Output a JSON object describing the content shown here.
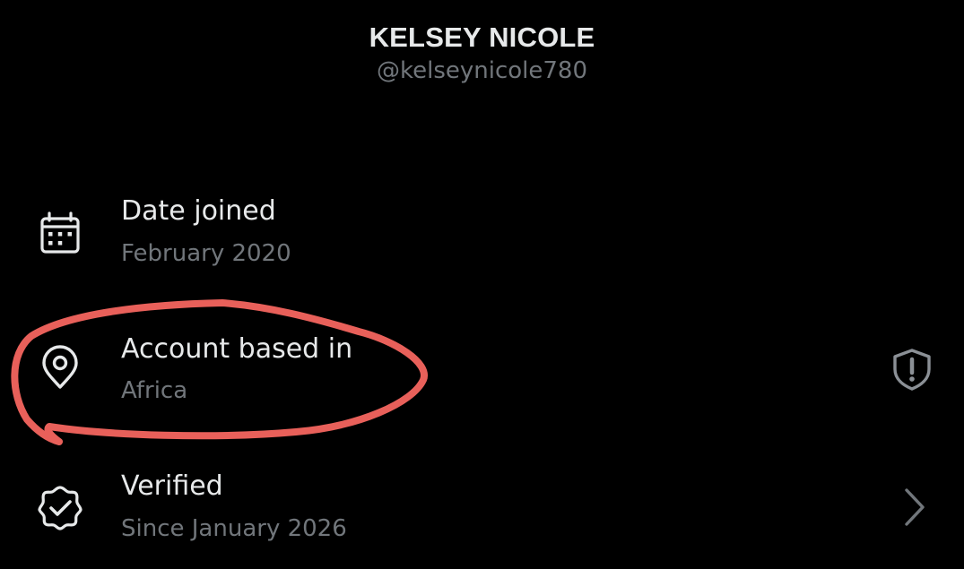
{
  "profile": {
    "display_name": "KELSEY NICOLE",
    "handle": "@kelseynicole780"
  },
  "rows": [
    {
      "label": "Date joined",
      "value": "February 2020",
      "icon": "calendar-icon"
    },
    {
      "label": "Account based in",
      "value": "Africa",
      "icon": "location-pin-icon",
      "trailing_icon": "shield-alert-icon"
    },
    {
      "label": "Verified",
      "value": "Since January 2026",
      "icon": "verified-badge-icon",
      "trailing_icon": "chevron-right-icon"
    }
  ],
  "colors": {
    "background": "#000000",
    "primary_text": "#e7e9ea",
    "secondary_text": "#71767b",
    "annotation": "#e8605a"
  }
}
